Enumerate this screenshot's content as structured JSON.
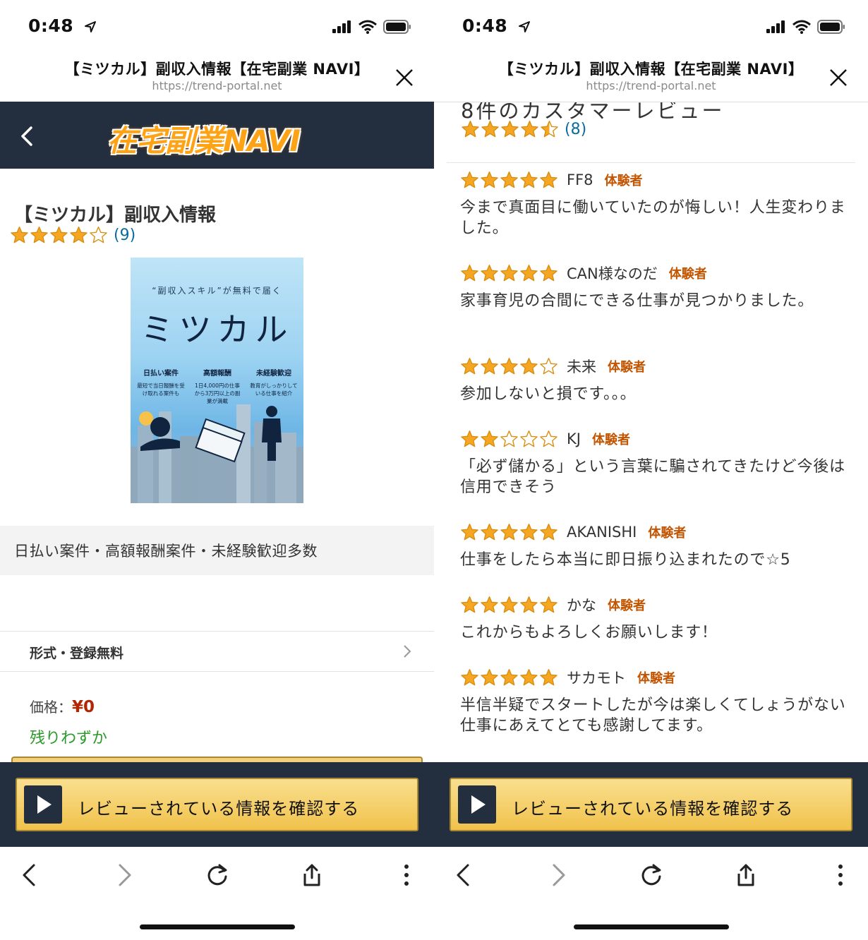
{
  "status": {
    "time": "0:48"
  },
  "browser": {
    "title": "【ミツカル】副収入情報【在宅副業 NAVI】",
    "url": "https://trend-portal.net"
  },
  "navbar": {
    "logo": "在宅副業NAVI"
  },
  "product": {
    "title": "【ミツカル】副収入情報",
    "rating": 4,
    "rating_count": "(9)",
    "banner": {
      "subtitle": "“副収入スキル”が無料で届く",
      "name": "ミツカル",
      "features": [
        {
          "head": "日払い案件",
          "desc": "最短で当日報酬を受け取れる案件も"
        },
        {
          "head": "高額報酬",
          "desc": "1日4,000円の仕事から3万円以上の副業が満載"
        },
        {
          "head": "未経験歓迎",
          "desc": "教育がしっかりしている仕事を紹介"
        }
      ]
    },
    "features_text": "日払い案件・高額報酬案件・未経験歓迎多数",
    "format_text": "形式・登録無料",
    "price_label": "価格：",
    "price_value": "¥0",
    "stock_text": "残りわずか"
  },
  "reviews_section": {
    "heading": "8件のカスタマーレビュー",
    "rating": 4.5,
    "rating_count": "(8)",
    "badge": "体験者",
    "reviews": [
      {
        "stars": 5,
        "user": "FF8",
        "text": "今まで真面目に働いていたのが悔しい！人生変わりました。"
      },
      {
        "stars": 5,
        "user": "CAN様なのだ",
        "text": "家事育児の合間にできる仕事が見つかりました。"
      },
      {
        "stars": 4,
        "user": "未来",
        "text": "参加しないと損です。。。"
      },
      {
        "stars": 2,
        "user": "KJ",
        "text": "「必ず儲かる」という言葉に騙されてきたけど今後は信用できそう"
      },
      {
        "stars": 5,
        "user": "AKANISHI",
        "text": "仕事をしたら本当に即日振り込まれたので☆5"
      },
      {
        "stars": 5,
        "user": "かな",
        "text": "これからもよろしくお願いします！"
      },
      {
        "stars": 5,
        "user": "サカモト",
        "text": "半信半疑でスタートしたが今は楽しくてしょうがない仕事にあえてとても感謝してます。"
      }
    ]
  },
  "cta": {
    "label": "レビューされている情報を確認する"
  },
  "colors": {
    "navbar": "#232f3e",
    "star": "#f5a623",
    "link": "#0a6b9f",
    "badge": "#c45500",
    "price": "#b12704",
    "stock": "#2b9a2b",
    "cta": "#f1c24b"
  }
}
